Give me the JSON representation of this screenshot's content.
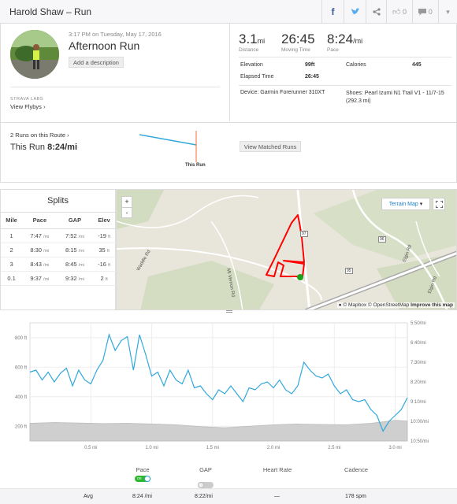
{
  "header": {
    "title": "Harold Shaw – Run",
    "kudos_count": "0",
    "comment_count": "0"
  },
  "activity": {
    "datetime": "3:17 PM on Tuesday, May 17, 2016",
    "name": "Afternoon Run",
    "add_description": "Add a description",
    "labs": "STRAVA LABS",
    "flyby": "View Flybys",
    "distance": "3.1",
    "distance_unit": "mi",
    "distance_label": "Distance",
    "moving_time": "26:45",
    "moving_time_label": "Moving Time",
    "pace": "8:24",
    "pace_unit": "/mi",
    "pace_label": "Pace",
    "elevation_label": "Elevation",
    "elevation": "99ft",
    "calories_label": "Calories",
    "calories": "445",
    "elapsed_label": "Elapsed Time",
    "elapsed": "26:45",
    "device": "Device: Garmin Forerunner 310XT",
    "shoes": "Shoes: Pearl Izumi N1 Trail V1 - 11/7-15 (292.3 mi)"
  },
  "route": {
    "runs_on_route": "2 Runs on this Route",
    "this_run_label": "This Run",
    "this_run_pace": "8:24/mi",
    "marker_label": "This Run",
    "view_matched": "View Matched Runs"
  },
  "splits": {
    "title": "Splits",
    "headers": [
      "Mile",
      "Pace",
      "GAP",
      "Elev"
    ],
    "rows": [
      [
        "1",
        "7:47",
        "7:52",
        "-19"
      ],
      [
        "2",
        "8:30",
        "8:15",
        "35"
      ],
      [
        "3",
        "8:43",
        "8:45",
        "-16"
      ],
      [
        "0.1",
        "9:37",
        "9:32",
        "2"
      ]
    ],
    "pace_unit": "/mi",
    "elev_unit": "ft"
  },
  "map": {
    "terrain_button": "Terrain Map",
    "zoom_in": "+",
    "zoom_out": "-",
    "attribution": "© Mapbox © OpenStreetMap",
    "improve": "Improve this map",
    "road_labels": [
      "Waddle Rd",
      "Mt Vernon Rd",
      "Elgin Rd",
      "Elgin Rd"
    ],
    "shields": [
      "97",
      "96",
      "95"
    ]
  },
  "chart_data": {
    "type": "line",
    "x_ticks": [
      "0.5 mi",
      "1.0 mi",
      "1.5 mi",
      "2.0 mi",
      "2.5 mi",
      "3.0 mi"
    ],
    "y_left_ticks": [
      "800 ft",
      "600 ft",
      "400 ft",
      "200 ft"
    ],
    "y_right_ticks": [
      "5:50/mi",
      "6:40/mi",
      "7:30/mi",
      "8:20/mi",
      "9:10/mi",
      "10:00/mi",
      "10:50/mi"
    ],
    "x_range": [
      0,
      3.1
    ],
    "pace_axis_range_min_per_mi": [
      350,
      650
    ],
    "elevation_axis_range_ft": [
      100,
      900
    ],
    "series": [
      {
        "key": "pace",
        "color": "#31a8dc",
        "x": [
          0,
          0.05,
          0.1,
          0.15,
          0.2,
          0.25,
          0.3,
          0.35,
          0.4,
          0.45,
          0.5,
          0.55,
          0.6,
          0.65,
          0.7,
          0.75,
          0.8,
          0.85,
          0.9,
          0.95,
          1.0,
          1.05,
          1.1,
          1.15,
          1.2,
          1.25,
          1.3,
          1.35,
          1.4,
          1.45,
          1.5,
          1.55,
          1.6,
          1.65,
          1.7,
          1.75,
          1.8,
          1.85,
          1.9,
          1.95,
          2.0,
          2.05,
          2.1,
          2.15,
          2.2,
          2.25,
          2.3,
          2.35,
          2.4,
          2.45,
          2.5,
          2.55,
          2.6,
          2.65,
          2.7,
          2.75,
          2.8,
          2.85,
          2.9,
          2.95,
          3.0,
          3.05,
          3.1
        ],
        "values": [
          475,
          470,
          495,
          475,
          500,
          478,
          465,
          510,
          470,
          495,
          505,
          470,
          445,
          380,
          420,
          395,
          385,
          470,
          380,
          430,
          485,
          475,
          510,
          470,
          495,
          505,
          470,
          515,
          510,
          530,
          545,
          520,
          530,
          510,
          530,
          550,
          515,
          520,
          505,
          500,
          515,
          495,
          520,
          530,
          510,
          450,
          470,
          485,
          490,
          480,
          510,
          530,
          520,
          545,
          550,
          545,
          570,
          585,
          625,
          600,
          585,
          570,
          540
        ]
      },
      {
        "key": "elevation",
        "color": "#cfcfcf",
        "x": [
          0,
          0.2,
          0.4,
          0.6,
          0.8,
          1.0,
          1.2,
          1.4,
          1.6,
          1.8,
          2.0,
          2.2,
          2.4,
          2.6,
          2.8,
          3.0,
          3.1
        ],
        "values": [
          220,
          225,
          222,
          218,
          220,
          215,
          210,
          198,
          190,
          200,
          210,
          215,
          212,
          210,
          220,
          240,
          235
        ]
      }
    ],
    "legend": [
      {
        "name": "Pace",
        "enabled": true,
        "toggle_label": "on"
      },
      {
        "name": "GAP",
        "enabled": false
      },
      {
        "name": "Heart Rate",
        "enabled": false
      },
      {
        "name": "Cadence",
        "enabled": false
      }
    ],
    "averages": {
      "label": "Avg",
      "pace": "8:24 /mi",
      "gap": "8:22/mi",
      "heart_rate": "—",
      "cadence": "178 spm"
    }
  }
}
